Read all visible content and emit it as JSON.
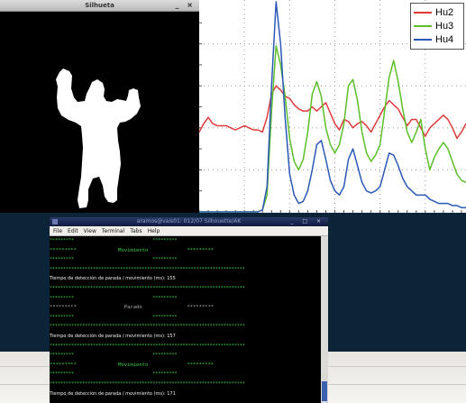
{
  "silhouette_window": {
    "title": "Silhueta",
    "buttons": "_ ×"
  },
  "chart_data": {
    "type": "line",
    "title": "",
    "xlabel": "",
    "ylabel": "",
    "legend_position": "top-right",
    "grid": true,
    "x": [
      0,
      1,
      2,
      3,
      4,
      5,
      6,
      7,
      8,
      9,
      10,
      11,
      12,
      13,
      14,
      15,
      16,
      17,
      18,
      19,
      20,
      21,
      22,
      23,
      24,
      25,
      26,
      27,
      28,
      29,
      30,
      31,
      32,
      33,
      34,
      35,
      36,
      37,
      38,
      39,
      40,
      41,
      42,
      43,
      44,
      45,
      46,
      47,
      48,
      49,
      50,
      51,
      52,
      53,
      54,
      55,
      56,
      57,
      58,
      59
    ],
    "xlim": [
      0,
      59
    ],
    "ylim": [
      0,
      100
    ],
    "series": [
      {
        "name": "Hu2",
        "color": "#e03b3b",
        "values": [
          38,
          42,
          45,
          42,
          41,
          41,
          41,
          40,
          39,
          40,
          41,
          40,
          39,
          39,
          38,
          45,
          56,
          60,
          58,
          55,
          54,
          51,
          49,
          48,
          48,
          50,
          48,
          50,
          52,
          47,
          42,
          39,
          44,
          43,
          40,
          42,
          43,
          41,
          38,
          42,
          46,
          50,
          53,
          51,
          49,
          45,
          41,
          44,
          44,
          40,
          36,
          40,
          42,
          44,
          46,
          44,
          40,
          35,
          38,
          42
        ]
      },
      {
        "name": "Hu3",
        "color": "#5cbf2a",
        "values": [
          0,
          0,
          0,
          0,
          0,
          0,
          0,
          0,
          0,
          0,
          0,
          0,
          0,
          0,
          1,
          8,
          48,
          79,
          70,
          55,
          35,
          24,
          20,
          25,
          38,
          56,
          62,
          55,
          40,
          32,
          28,
          32,
          42,
          60,
          63,
          53,
          38,
          28,
          24,
          27,
          32,
          48,
          64,
          72,
          62,
          49,
          38,
          33,
          38,
          44,
          30,
          20,
          26,
          30,
          33,
          30,
          24,
          18,
          15,
          14
        ]
      },
      {
        "name": "Hu4",
        "color": "#2b58b8",
        "values": [
          0,
          0,
          0,
          0,
          0,
          0,
          0,
          0,
          0,
          0,
          0,
          0,
          0,
          0,
          1,
          12,
          60,
          100,
          80,
          45,
          18,
          8,
          4,
          5,
          10,
          20,
          32,
          34,
          25,
          15,
          10,
          8,
          12,
          25,
          30,
          22,
          14,
          10,
          9,
          10,
          12,
          20,
          28,
          27,
          22,
          16,
          12,
          10,
          8,
          8,
          8,
          6,
          5,
          4,
          4,
          4,
          3,
          3,
          2,
          2
        ]
      }
    ]
  },
  "terminal": {
    "title": "aramos@vais01: 012/07 Silhouette/AK",
    "buttons": "_ □ ×",
    "menu": [
      "File",
      "Edit",
      "View",
      "Terminal",
      "Tabs",
      "Help"
    ],
    "lines": [
      {
        "kind": "green",
        "text": "*********                             *********"
      },
      {
        "kind": "state",
        "text": "*********              Movimiento             *********"
      },
      {
        "kind": "green",
        "text": "*********                             *********"
      },
      {
        "kind": "green",
        "text": "************************************************************************"
      },
      {
        "kind": "white",
        "text": "Tiempo de detección de parada / movimiento (ms): 155"
      },
      {
        "kind": "green",
        "text": "************************************************************************"
      },
      {
        "kind": "green",
        "text": "*********                             *********"
      },
      {
        "kind": "state-gray",
        "text": "*********                Parado               *********"
      },
      {
        "kind": "green",
        "text": "*********                             *********"
      },
      {
        "kind": "green",
        "text": "************************************************************************"
      },
      {
        "kind": "white",
        "text": "Tiempo de detección de parada / movimiento (ms): 157"
      },
      {
        "kind": "green",
        "text": "************************************************************************"
      },
      {
        "kind": "green",
        "text": "*********                             *********"
      },
      {
        "kind": "state",
        "text": "*********              Movimiento             *********"
      },
      {
        "kind": "green",
        "text": "*********                             *********"
      },
      {
        "kind": "green",
        "text": "************************************************************************"
      },
      {
        "kind": "white",
        "text": "Tiempo de detección de parada / movimiento (ms): 171"
      }
    ]
  }
}
